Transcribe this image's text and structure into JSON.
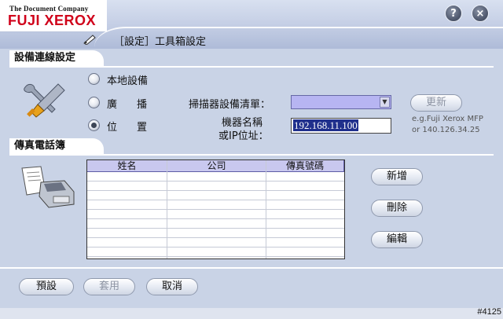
{
  "window": {
    "brand_tagline": "The Document Company",
    "brand_name": "FUJI XEROX",
    "title": "［設定］工具箱設定",
    "help_label": "?",
    "close_label": "×"
  },
  "connection": {
    "section_title": "設備連線設定",
    "options": [
      {
        "label": "本地設備",
        "selected": false
      },
      {
        "label": "廣　播",
        "selected": false
      },
      {
        "label": "位　置",
        "selected": true
      }
    ],
    "scanner_list_label": "掃描器設備清單：",
    "scanner_list_value": "",
    "refresh_label": "更新",
    "machine_label_line1": "機器名稱",
    "machine_label_line2": "或IP位址：",
    "machine_value": "192.168.11.100",
    "hint_line1": "e.g.Fuji Xerox MFP",
    "hint_line2": "or 140.126.34.25"
  },
  "phonebook": {
    "section_title": "傳真電話簿",
    "columns": [
      "姓名",
      "公司",
      "傳真號碼"
    ],
    "rows": [],
    "add_label": "新增",
    "delete_label": "刪除",
    "edit_label": "編輯"
  },
  "footer": {
    "default_label": "預設",
    "apply_label": "套用",
    "cancel_label": "取消",
    "corner_id": "#4125"
  },
  "colors": {
    "brand_red": "#d0021b",
    "panel_bg": "#c9d3e6",
    "header_bg": "#c9c8ef",
    "input_selection": "#1f2f8c",
    "dropdown_bg": "#b7b5f2"
  }
}
